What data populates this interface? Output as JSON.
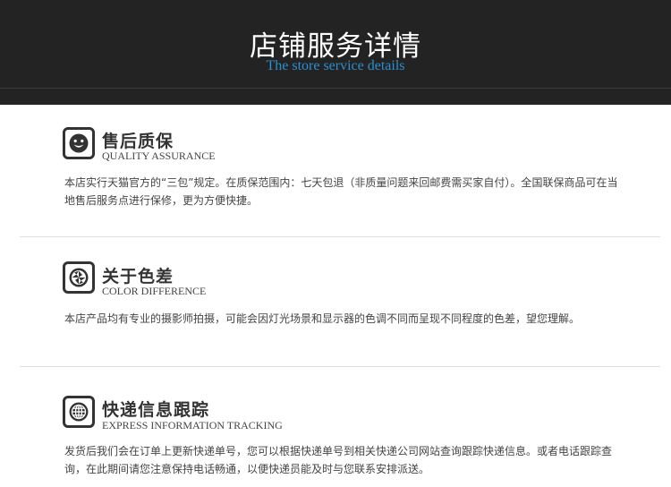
{
  "header": {
    "title": "店铺服务详情",
    "subtitle": "The store service details"
  },
  "sections": [
    {
      "icon": "smiley-icon",
      "title": "售后质保",
      "subtitle": "QUALITY ASSURANCE",
      "text": "本店实行天猫官方的“三包”规定。在质保范围内：七天包退（非质量问题来回邮费需买家自付）。全国联保商品可在当地售后服务点进行保修，更为方便快捷。"
    },
    {
      "icon": "aperture-icon",
      "title": "关于色差",
      "subtitle": "COLOR DIFFERENCE",
      "text": "本店产品均有专业的摄影师拍摄，可能会因灯光场景和显示器的色调不同而呈现不同程度的色差，望您理解。"
    },
    {
      "icon": "globe-icon",
      "title": "快递信息跟踪",
      "subtitle": "EXPRESS INFORMATION TRACKING",
      "text": "发货后我们会在订单上更新快递单号，您可以根据快递单号到相关快递公司网站查询跟踪快递信息。或者电话跟踪查询，在此期间请您注意保持电话畅通，以便快递员能及时与您联系安排派送。"
    }
  ]
}
